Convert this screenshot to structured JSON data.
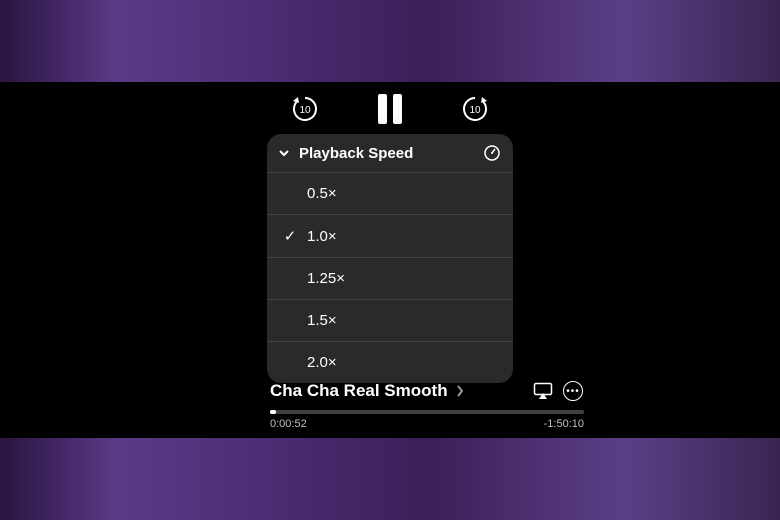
{
  "controls": {
    "skip_back_seconds": "10",
    "skip_forward_seconds": "10"
  },
  "menu": {
    "title": "Playback Speed",
    "options": [
      {
        "label": "0.5×",
        "selected": false
      },
      {
        "label": "1.0×",
        "selected": true
      },
      {
        "label": "1.25×",
        "selected": false
      },
      {
        "label": "1.5×",
        "selected": false
      },
      {
        "label": "2.0×",
        "selected": false
      }
    ]
  },
  "now_playing": {
    "title": "Cha Cha Real Smooth",
    "elapsed": "0:00:52",
    "remaining": "-1:50:10",
    "progress_percent": 2
  }
}
